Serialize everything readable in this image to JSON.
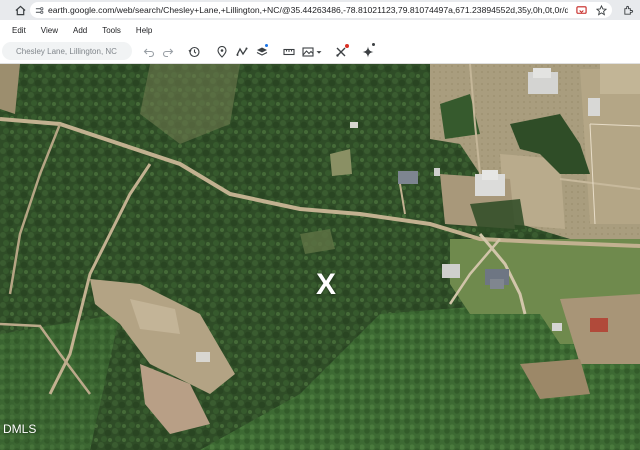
{
  "browser": {
    "url": "earth.google.com/web/search/Chesley+Lane,+Lillington,+NC/@35.44263486,-78.81021123,79.81074497a,671.23894552d,35y,0h,0t,0r/data=CiwiJgokCbfm82..."
  },
  "menu": {
    "items": [
      "Edit",
      "View",
      "Add",
      "Tools",
      "Help"
    ]
  },
  "toolbar": {
    "search_placeholder": "Chesley Lane, Lillington, NC"
  },
  "map": {
    "marker_label": "X",
    "watermark": "DMLS"
  },
  "colors": {
    "forest_dark": "#2d4a25",
    "forest_mid": "#3b5e30",
    "clearing": "#b8a98a",
    "dirt_road": "#c9b99a",
    "field": "#a89b7c"
  }
}
